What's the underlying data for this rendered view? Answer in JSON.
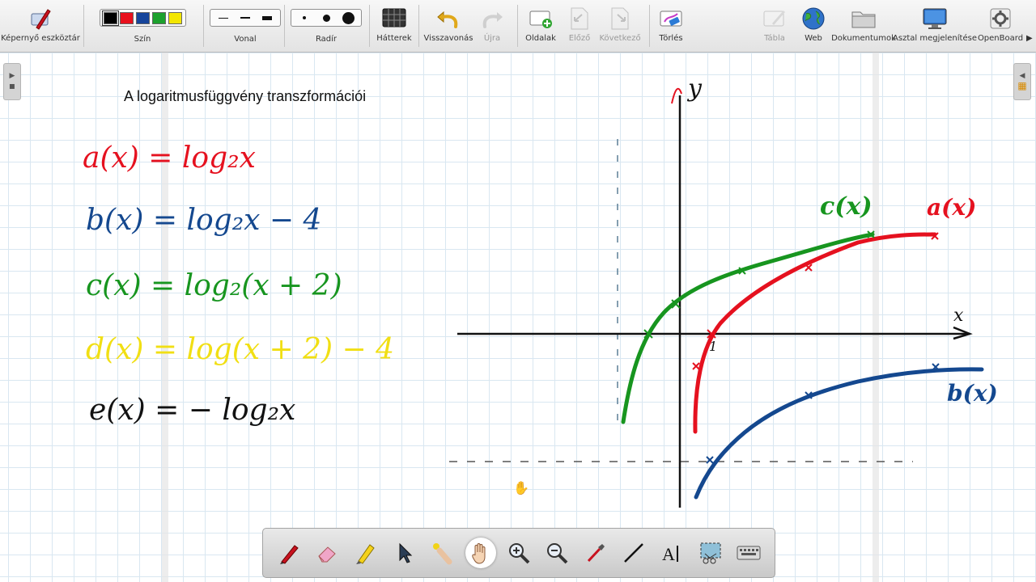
{
  "toolbar": {
    "screen_tools": "Képernyő eszköztár",
    "color": "Szín",
    "line": "Vonal",
    "eraser": "Radír",
    "backgrounds": "Hátterek",
    "undo": "Visszavonás",
    "redo": "Újra",
    "pages": "Oldalak",
    "previous": "Előző",
    "next": "Következő",
    "clear": "Törlés",
    "board": "Tábla",
    "web": "Web",
    "documents": "Dokumentumok",
    "show_desktop": "Asztal megjelenítése",
    "openboard": "OpenBoard",
    "colors": [
      "#000000",
      "#e8101c",
      "#17459b",
      "#1da12e",
      "#f3e600"
    ]
  },
  "board": {
    "title": "A logaritmusfüggvény transzformációi",
    "formulas": {
      "a": "a(x) = log₂x",
      "b": "b(x) = log₂x − 4",
      "c": "c(x) = log₂(x + 2)",
      "d": "d(x) = log(x + 2) − 4",
      "e": "e(x) = − log₂x"
    },
    "graph": {
      "y_label": "y",
      "x_label": "x",
      "one_label": "1",
      "label_a": "a(x)",
      "label_b": "b(x)",
      "label_c": "c(x)"
    },
    "ink_colors": {
      "red": "#e5111f",
      "blue": "#14488f",
      "green": "#17951f",
      "yellow": "#f1df14",
      "black": "#111111"
    }
  },
  "bottom_tools": [
    "pen",
    "eraser",
    "highlighter",
    "pointer",
    "laser",
    "hand",
    "zoom-in",
    "zoom-out",
    "pipette",
    "line",
    "text",
    "capture",
    "keyboard"
  ]
}
